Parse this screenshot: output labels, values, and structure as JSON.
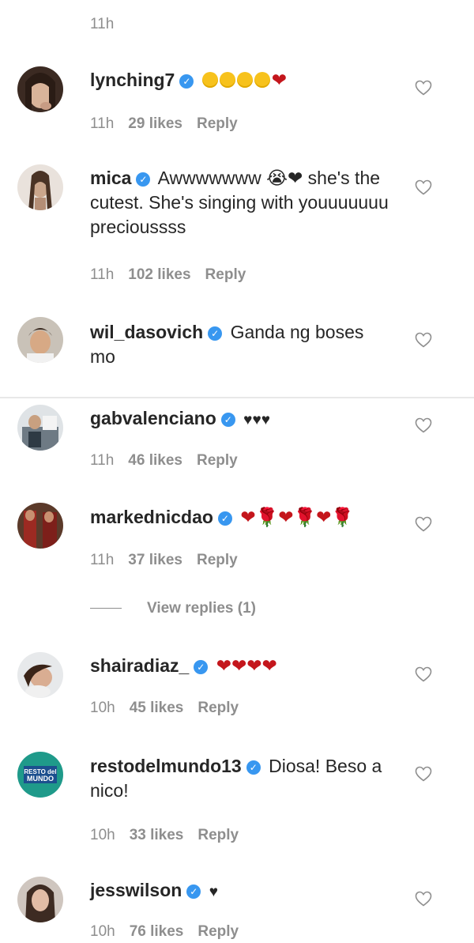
{
  "top_time": "11h",
  "reply_label": "Reply",
  "comments": [
    {
      "username": "lynching7",
      "text": "",
      "emoji": "😊😊😊😊❤",
      "time": "11h",
      "likes": "29 likes"
    },
    {
      "username": "mica",
      "text": "Awwwwwww 😭❤ she's the cutest. She's singing with youuuuuuu precioussss",
      "time": "11h",
      "likes": "102 likes"
    },
    {
      "username": "wil_dasovich",
      "text": "Ganda ng boses mo",
      "time": "",
      "likes": ""
    },
    {
      "username": "gabvalenciano",
      "text": "♥♥♥",
      "time": "11h",
      "likes": "46 likes"
    },
    {
      "username": "markednicdao",
      "text": "❤🌹❤🌹❤🌹",
      "time": "11h",
      "likes": "37 likes"
    },
    {
      "username": "shairadiaz_",
      "text": "❤❤❤❤",
      "time": "10h",
      "likes": "45 likes"
    },
    {
      "username": "restodelmundo13",
      "text": "Diosa! Beso a nico!",
      "time": "10h",
      "likes": "33 likes"
    },
    {
      "username": "jesswilson",
      "text": "♥",
      "time": "10h",
      "likes": "76 likes"
    }
  ],
  "view_replies": "View replies (1)",
  "resto_logo_text": "RESTO del MUNDO",
  "colors": {
    "verified": "#3897f0",
    "meta_gray": "#8e8e8e",
    "heart_red": "#c4161c"
  }
}
